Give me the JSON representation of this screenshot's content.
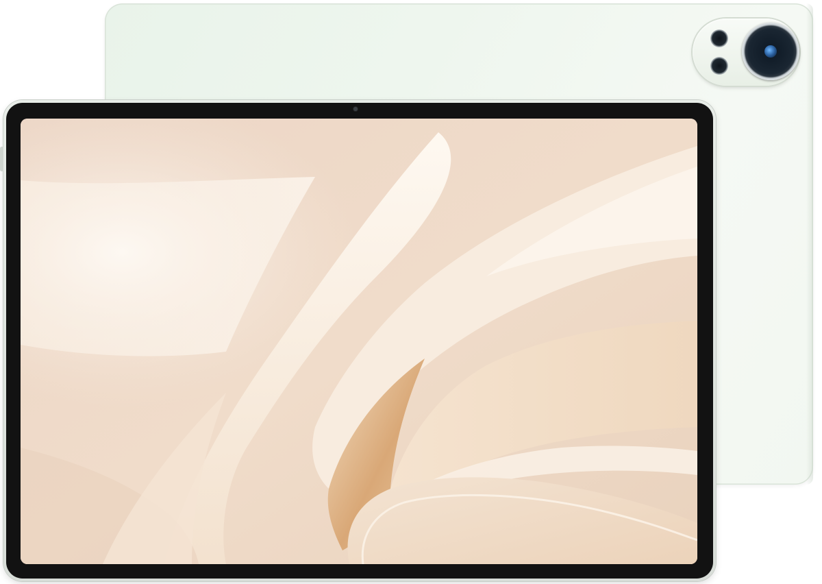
{
  "scene": {
    "subject": "tablet-device",
    "view": "front-and-rear",
    "colors": {
      "back_panel": "#eef6ee",
      "frame": "#dfe4df",
      "bezel": "#121212",
      "wallpaper_base": "#efd9c8",
      "wallpaper_highlight": "#fbf4ea",
      "wallpaper_gold": "#d9a877"
    },
    "icons": {
      "rear_camera": "camera-module-icon",
      "front_camera": "front-camera-icon"
    }
  }
}
